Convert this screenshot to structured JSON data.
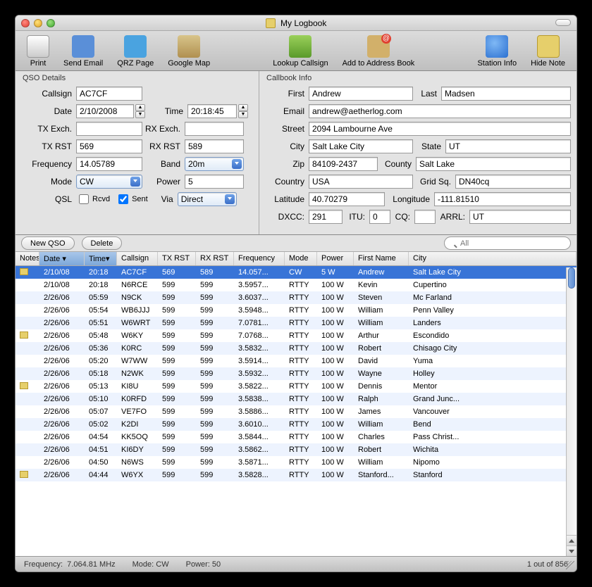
{
  "window": {
    "title": "My Logbook"
  },
  "toolbar": {
    "print": "Print",
    "send_email": "Send Email",
    "qrz": "QRZ Page",
    "gmap": "Google Map",
    "lookup": "Lookup Callsign",
    "addrbook": "Add to Address Book",
    "station": "Station Info",
    "hidenote": "Hide Note"
  },
  "qso": {
    "heading": "QSO Details",
    "callsign_lbl": "Callsign",
    "callsign": "AC7CF",
    "date_lbl": "Date",
    "date": "2/10/2008",
    "time_lbl": "Time",
    "time": "20:18:45",
    "txexch_lbl": "TX Exch.",
    "txexch": "",
    "rxexch_lbl": "RX Exch.",
    "rxexch": "",
    "txrst_lbl": "TX RST",
    "txrst": "569",
    "rxrst_lbl": "RX RST",
    "rxrst": "589",
    "freq_lbl": "Frequency",
    "freq": "14.05789",
    "band_lbl": "Band",
    "band": "20m",
    "mode_lbl": "Mode",
    "mode": "CW",
    "power_lbl": "Power",
    "power": "5",
    "qsl_lbl": "QSL",
    "rcvd_lbl": "Rcvd",
    "sent_lbl": "Sent",
    "rcvd": false,
    "sent": true,
    "via_lbl": "Via",
    "via": "Direct"
  },
  "cb": {
    "heading": "Callbook Info",
    "first_lbl": "First",
    "first": "Andrew",
    "last_lbl": "Last",
    "last": "Madsen",
    "email_lbl": "Email",
    "email": "andrew@aetherlog.com",
    "street_lbl": "Street",
    "street": "2094 Lambourne Ave",
    "city_lbl": "City",
    "city": "Salt Lake City",
    "state_lbl": "State",
    "state": "UT",
    "zip_lbl": "Zip",
    "zip": "84109-2437",
    "county_lbl": "County",
    "county": "Salt Lake",
    "country_lbl": "Country",
    "country": "USA",
    "grid_lbl": "Grid Sq.",
    "grid": "DN40cq",
    "lat_lbl": "Latitude",
    "lat": "40.70279",
    "lon_lbl": "Longitude",
    "lon": "-111.81510",
    "dxcc_lbl": "DXCC:",
    "dxcc": "291",
    "itu_lbl": "ITU:",
    "itu": "0",
    "cq_lbl": "CQ:",
    "cq": "",
    "arrl_lbl": "ARRL:",
    "arrl": "UT"
  },
  "actions": {
    "new_qso": "New QSO",
    "delete": "Delete",
    "search_ph": "All"
  },
  "columns": {
    "notes": "Notes",
    "date": "Date",
    "time": "Time",
    "callsign": "Callsign",
    "txrst": "TX RST",
    "rxrst": "RX RST",
    "freq": "Frequency",
    "mode": "Mode",
    "power": "Power",
    "first": "First Name",
    "city": "City"
  },
  "rows": [
    {
      "note": true,
      "date": "2/10/08",
      "time": "20:18",
      "call": "AC7CF",
      "tx": "569",
      "rx": "589",
      "freq": "14.057...",
      "mode": "CW",
      "power": "5 W",
      "first": "Andrew",
      "city": "Salt Lake City",
      "sel": true
    },
    {
      "note": false,
      "date": "2/10/08",
      "time": "20:18",
      "call": "N6RCE",
      "tx": "599",
      "rx": "599",
      "freq": "3.5957...",
      "mode": "RTTY",
      "power": "100 W",
      "first": "Kevin",
      "city": "Cupertino"
    },
    {
      "note": false,
      "date": "2/26/06",
      "time": "05:59",
      "call": "N9CK",
      "tx": "599",
      "rx": "599",
      "freq": "3.6037...",
      "mode": "RTTY",
      "power": "100 W",
      "first": "Steven",
      "city": "Mc Farland"
    },
    {
      "note": false,
      "date": "2/26/06",
      "time": "05:54",
      "call": "WB6JJJ",
      "tx": "599",
      "rx": "599",
      "freq": "3.5948...",
      "mode": "RTTY",
      "power": "100 W",
      "first": "William",
      "city": "Penn Valley"
    },
    {
      "note": false,
      "date": "2/26/06",
      "time": "05:51",
      "call": "W6WRT",
      "tx": "599",
      "rx": "599",
      "freq": "7.0781...",
      "mode": "RTTY",
      "power": "100 W",
      "first": "William",
      "city": "Landers"
    },
    {
      "note": true,
      "date": "2/26/06",
      "time": "05:48",
      "call": "W6KY",
      "tx": "599",
      "rx": "599",
      "freq": "7.0768...",
      "mode": "RTTY",
      "power": "100 W",
      "first": "Arthur",
      "city": "Escondido"
    },
    {
      "note": false,
      "date": "2/26/06",
      "time": "05:36",
      "call": "K0RC",
      "tx": "599",
      "rx": "599",
      "freq": "3.5832...",
      "mode": "RTTY",
      "power": "100 W",
      "first": "Robert",
      "city": "Chisago City"
    },
    {
      "note": false,
      "date": "2/26/06",
      "time": "05:20",
      "call": "W7WW",
      "tx": "599",
      "rx": "599",
      "freq": "3.5914...",
      "mode": "RTTY",
      "power": "100 W",
      "first": "David",
      "city": "Yuma"
    },
    {
      "note": false,
      "date": "2/26/06",
      "time": "05:18",
      "call": "N2WK",
      "tx": "599",
      "rx": "599",
      "freq": "3.5932...",
      "mode": "RTTY",
      "power": "100 W",
      "first": "Wayne",
      "city": "Holley"
    },
    {
      "note": true,
      "date": "2/26/06",
      "time": "05:13",
      "call": "KI8U",
      "tx": "599",
      "rx": "599",
      "freq": "3.5822...",
      "mode": "RTTY",
      "power": "100 W",
      "first": "Dennis",
      "city": "Mentor"
    },
    {
      "note": false,
      "date": "2/26/06",
      "time": "05:10",
      "call": "K0RFD",
      "tx": "599",
      "rx": "599",
      "freq": "3.5838...",
      "mode": "RTTY",
      "power": "100 W",
      "first": "Ralph",
      "city": "Grand Junc..."
    },
    {
      "note": false,
      "date": "2/26/06",
      "time": "05:07",
      "call": "VE7FO",
      "tx": "599",
      "rx": "599",
      "freq": "3.5886...",
      "mode": "RTTY",
      "power": "100 W",
      "first": "James",
      "city": "Vancouver"
    },
    {
      "note": false,
      "date": "2/26/06",
      "time": "05:02",
      "call": "K2DI",
      "tx": "599",
      "rx": "599",
      "freq": "3.6010...",
      "mode": "RTTY",
      "power": "100 W",
      "first": "William",
      "city": "Bend"
    },
    {
      "note": false,
      "date": "2/26/06",
      "time": "04:54",
      "call": "KK5OQ",
      "tx": "599",
      "rx": "599",
      "freq": "3.5844...",
      "mode": "RTTY",
      "power": "100 W",
      "first": "Charles",
      "city": "Pass Christ..."
    },
    {
      "note": false,
      "date": "2/26/06",
      "time": "04:51",
      "call": "KI6DY",
      "tx": "599",
      "rx": "599",
      "freq": "3.5862...",
      "mode": "RTTY",
      "power": "100 W",
      "first": "Robert",
      "city": "Wichita"
    },
    {
      "note": false,
      "date": "2/26/06",
      "time": "04:50",
      "call": "N6WS",
      "tx": "599",
      "rx": "599",
      "freq": "3.5871...",
      "mode": "RTTY",
      "power": "100 W",
      "first": "William",
      "city": "Nipomo"
    },
    {
      "note": true,
      "date": "2/26/06",
      "time": "04:44",
      "call": "W6YX",
      "tx": "599",
      "rx": "599",
      "freq": "3.5828...",
      "mode": "RTTY",
      "power": "100 W",
      "first": "Stanford...",
      "city": "Stanford"
    }
  ],
  "status": {
    "freq_lbl": "Frequency:",
    "freq": "7.064.81 MHz",
    "mode_lbl": "Mode:",
    "mode": "CW",
    "power_lbl": "Power:",
    "power": "50",
    "count": "1 out of 856"
  }
}
